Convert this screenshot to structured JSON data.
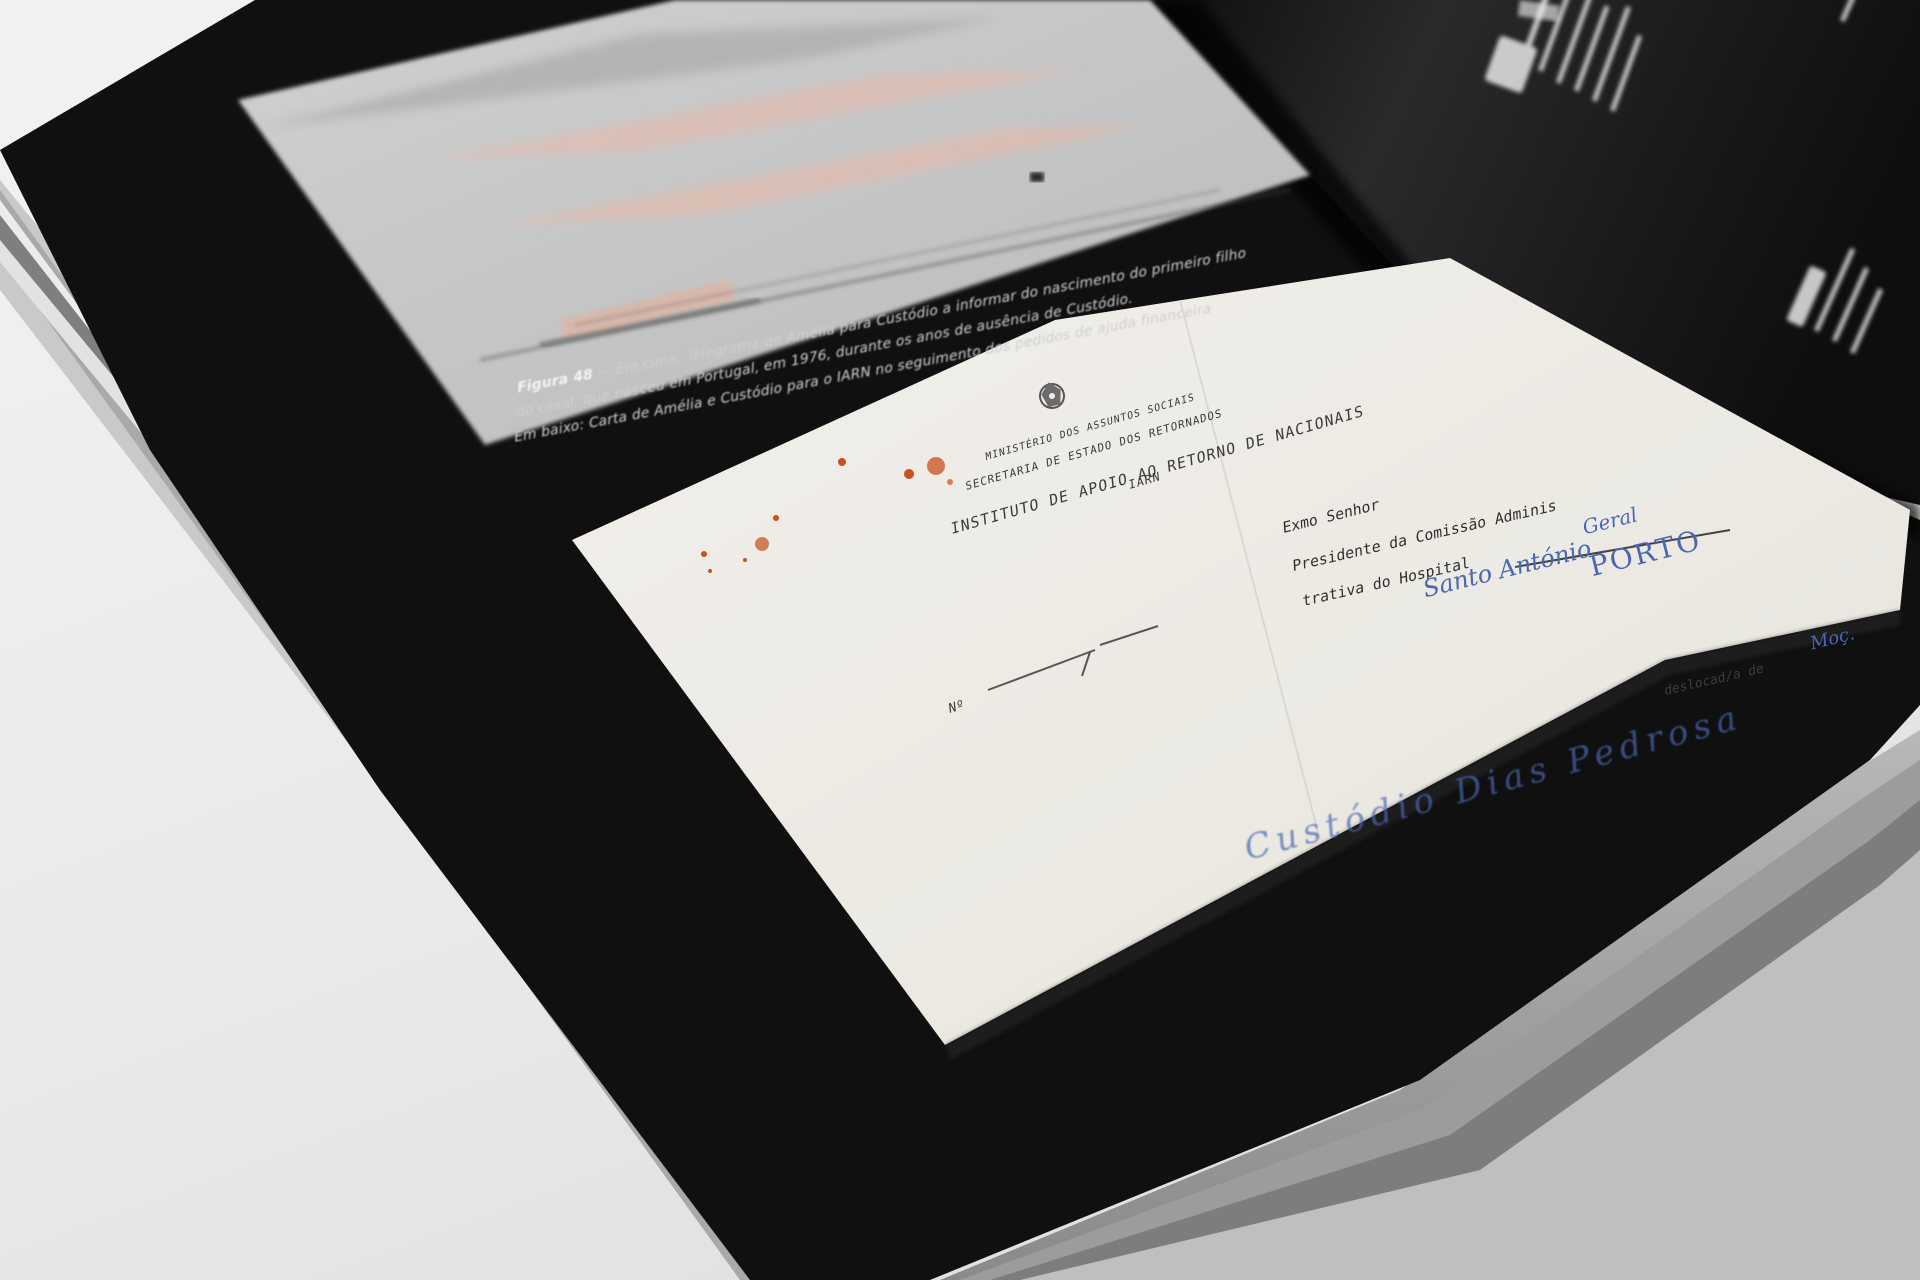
{
  "caption": {
    "figure_label": "Figura 48",
    "line1": "— Em cima: Telegrama de Amélia para Custódio a informar do nascimento do primeiro filho",
    "line2": "do casal, que nasceu em Portugal, em 1976, durante os anos de ausência de Custódio.",
    "line3": "Em baixo: Carta de Amélia e Custódio para o IARN no seguimento dos pedidos de ajuda financeira"
  },
  "letter": {
    "ministry": "MINISTÉRIO DOS ASSUNTOS SOCIAIS",
    "secretariat": "SECRETARIA DE ESTADO DOS RETORNADOS",
    "institute": "INSTITUTO DE APOIO AO RETORNO DE NACIONAIS",
    "acronym": "IARN",
    "number_label": "Nº",
    "salutation": "Exmo Senhor",
    "recipient_line1": "Presidente da Comissão Adminis",
    "recipient_line2": "trativa do Hospital",
    "handwritten_hospital": "Geral",
    "handwritten_saint": "Santo António",
    "handwritten_city": "PORTO",
    "displaced_label": "deslocad/a de",
    "handwritten_origin": "Moç.",
    "handwritten_name": "Custódio Dias Pedrosa"
  },
  "colors": {
    "page_black": "#101010",
    "paper": "#efece6",
    "ink_blue": "#4a67b3",
    "stain": "#c8501f"
  }
}
